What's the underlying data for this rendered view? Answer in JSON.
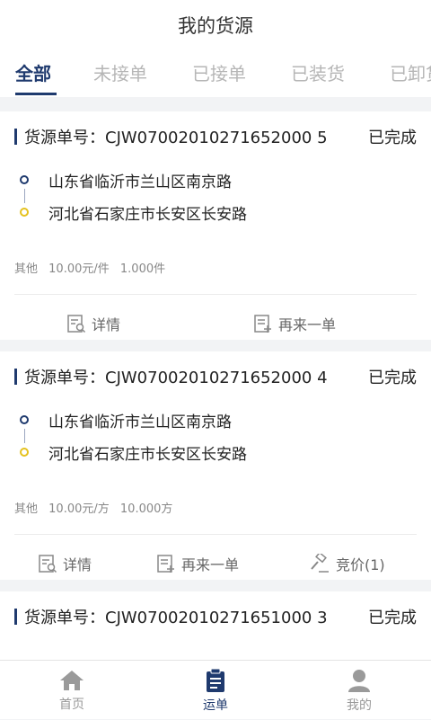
{
  "header": {
    "title": "我的货源"
  },
  "tabs": [
    {
      "label": "全部",
      "active": true
    },
    {
      "label": "未接单",
      "active": false
    },
    {
      "label": "已接单",
      "active": false
    },
    {
      "label": "已装货",
      "active": false
    },
    {
      "label": "已卸货",
      "active": false
    }
  ],
  "cards": [
    {
      "order_label": "货源单号：",
      "order_no": "CJW07002010271652000 5",
      "status": "已完成",
      "from": "山东省临沂市兰山区南京路",
      "to": "河北省石家庄市长安区长安路",
      "cargo_type": "其他",
      "price": "10.00元/件",
      "quantity": "1.000件",
      "actions": {
        "detail": "详情",
        "reorder": "再来一单"
      }
    },
    {
      "order_label": "货源单号：",
      "order_no": "CJW07002010271652000 4",
      "status": "已完成",
      "from": "山东省临沂市兰山区南京路",
      "to": "河北省石家庄市长安区长安路",
      "cargo_type": "其他",
      "price": "10.00元/方",
      "quantity": "10.000方",
      "actions": {
        "detail": "详情",
        "reorder": "再来一单",
        "bid": "竞价(1)"
      }
    },
    {
      "order_label": "货源单号：",
      "order_no": "CJW07002010271651000 3",
      "status": "已完成"
    }
  ],
  "bottom_nav": [
    {
      "label": "首页",
      "icon": "home-icon",
      "active": false
    },
    {
      "label": "运单",
      "icon": "clipboard-icon",
      "active": true
    },
    {
      "label": "我的",
      "icon": "user-icon",
      "active": false
    }
  ],
  "colors": {
    "primary": "#1f3a6e",
    "accent_yellow": "#e5c21f",
    "inactive": "#b6b6b6"
  }
}
